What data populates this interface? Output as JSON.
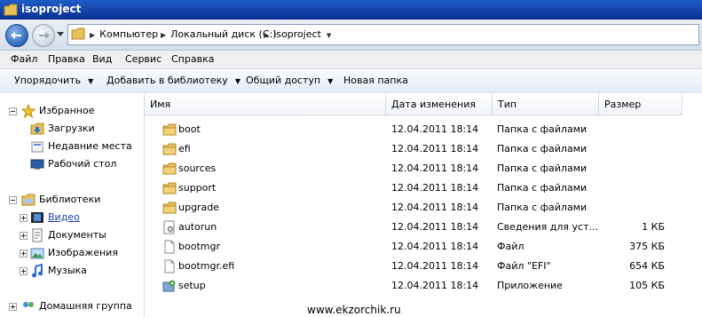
{
  "window": {
    "title": "isoproject"
  },
  "address": {
    "crumbs": [
      "Компьютер",
      "Локальный диск (C:)",
      "isoproject"
    ]
  },
  "menu": [
    "Файл",
    "Правка",
    "Вид",
    "Сервис",
    "Справка"
  ],
  "commands": [
    {
      "label": "Упорядочить",
      "dropdown": true
    },
    {
      "label": "Добавить в библиотеку",
      "dropdown": true
    },
    {
      "label": "Общий доступ",
      "dropdown": true
    },
    {
      "label": "Новая папка",
      "dropdown": false
    }
  ],
  "nav": {
    "favorites": {
      "label": "Избранное",
      "items": [
        "Загрузки",
        "Недавние места",
        "Рабочий стол"
      ]
    },
    "libraries": {
      "label": "Библиотеки",
      "items": [
        "Видео",
        "Документы",
        "Изображения",
        "Музыка"
      ]
    },
    "homegroup_partial": "Домашняя группа"
  },
  "columns": [
    "Имя",
    "Дата изменения",
    "Тип",
    "Размер"
  ],
  "files": [
    {
      "icon": "folder-icon",
      "name": "boot",
      "date": "12.04.2011 18:14",
      "type": "Папка с файлами",
      "size": ""
    },
    {
      "icon": "folder-icon",
      "name": "efi",
      "date": "12.04.2011 18:14",
      "type": "Папка с файлами",
      "size": ""
    },
    {
      "icon": "folder-icon",
      "name": "sources",
      "date": "12.04.2011 18:14",
      "type": "Папка с файлами",
      "size": ""
    },
    {
      "icon": "folder-icon",
      "name": "support",
      "date": "12.04.2011 18:14",
      "type": "Папка с файлами",
      "size": ""
    },
    {
      "icon": "folder-icon",
      "name": "upgrade",
      "date": "12.04.2011 18:14",
      "type": "Папка с файлами",
      "size": ""
    },
    {
      "icon": "settings-file-icon",
      "name": "autorun",
      "date": "12.04.2011 18:14",
      "type": "Сведения для уст...",
      "size": "1 КБ"
    },
    {
      "icon": "file-icon",
      "name": "bootmgr",
      "date": "12.04.2011 18:14",
      "type": "Файл",
      "size": "375 КБ"
    },
    {
      "icon": "file-icon",
      "name": "bootmgr.efi",
      "date": "12.04.2011 18:14",
      "type": "Файл \"EFI\"",
      "size": "654 КБ"
    },
    {
      "icon": "setup-icon",
      "name": "setup",
      "date": "12.04.2011 18:14",
      "type": "Приложение",
      "size": "105 КБ"
    }
  ],
  "watermark": "www.ekzorchik.ru"
}
